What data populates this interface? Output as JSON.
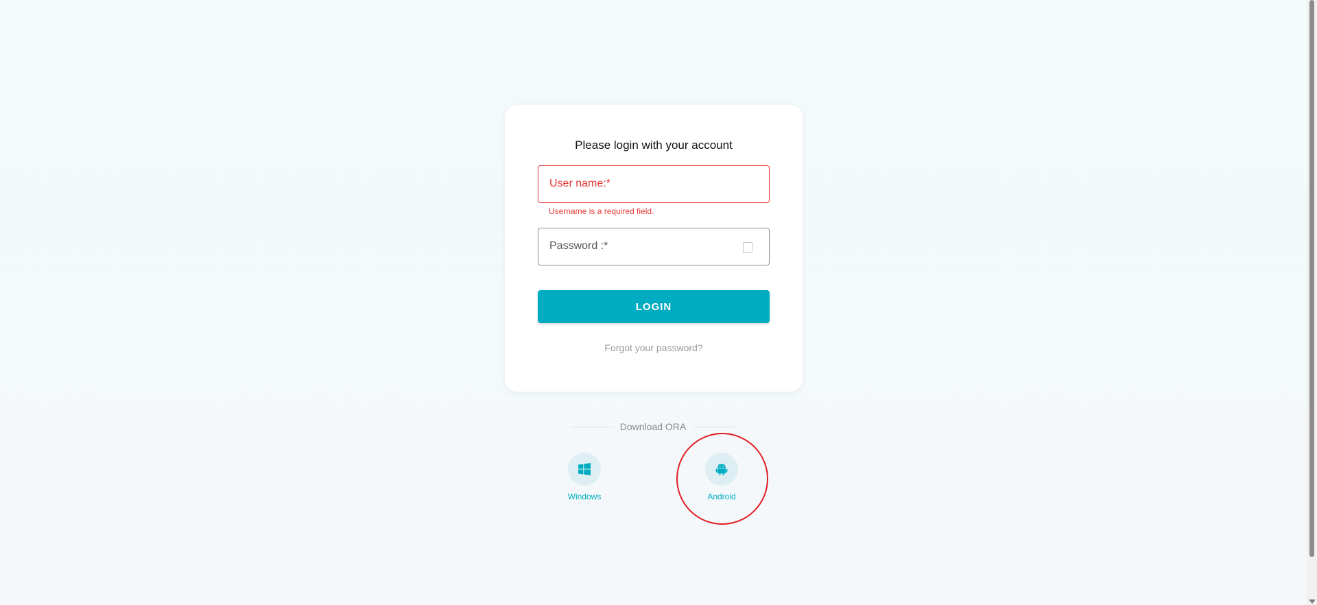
{
  "login_card": {
    "title": "Please login with your account",
    "username": {
      "label": "User name:*",
      "value": "",
      "error": "Username is a required field."
    },
    "password": {
      "label": "Password :*",
      "value": ""
    },
    "login_button": "LOGIN",
    "forgot_link": "Forgot your password?"
  },
  "download": {
    "heading": "Download ORA",
    "items": [
      {
        "label": "Windows",
        "icon": "windows-icon"
      },
      {
        "label": "Android",
        "icon": "android-icon"
      }
    ]
  },
  "colors": {
    "accent": "#00acc1",
    "error": "#e53935",
    "highlight": "#e01c24",
    "background": "#f3fafc"
  }
}
